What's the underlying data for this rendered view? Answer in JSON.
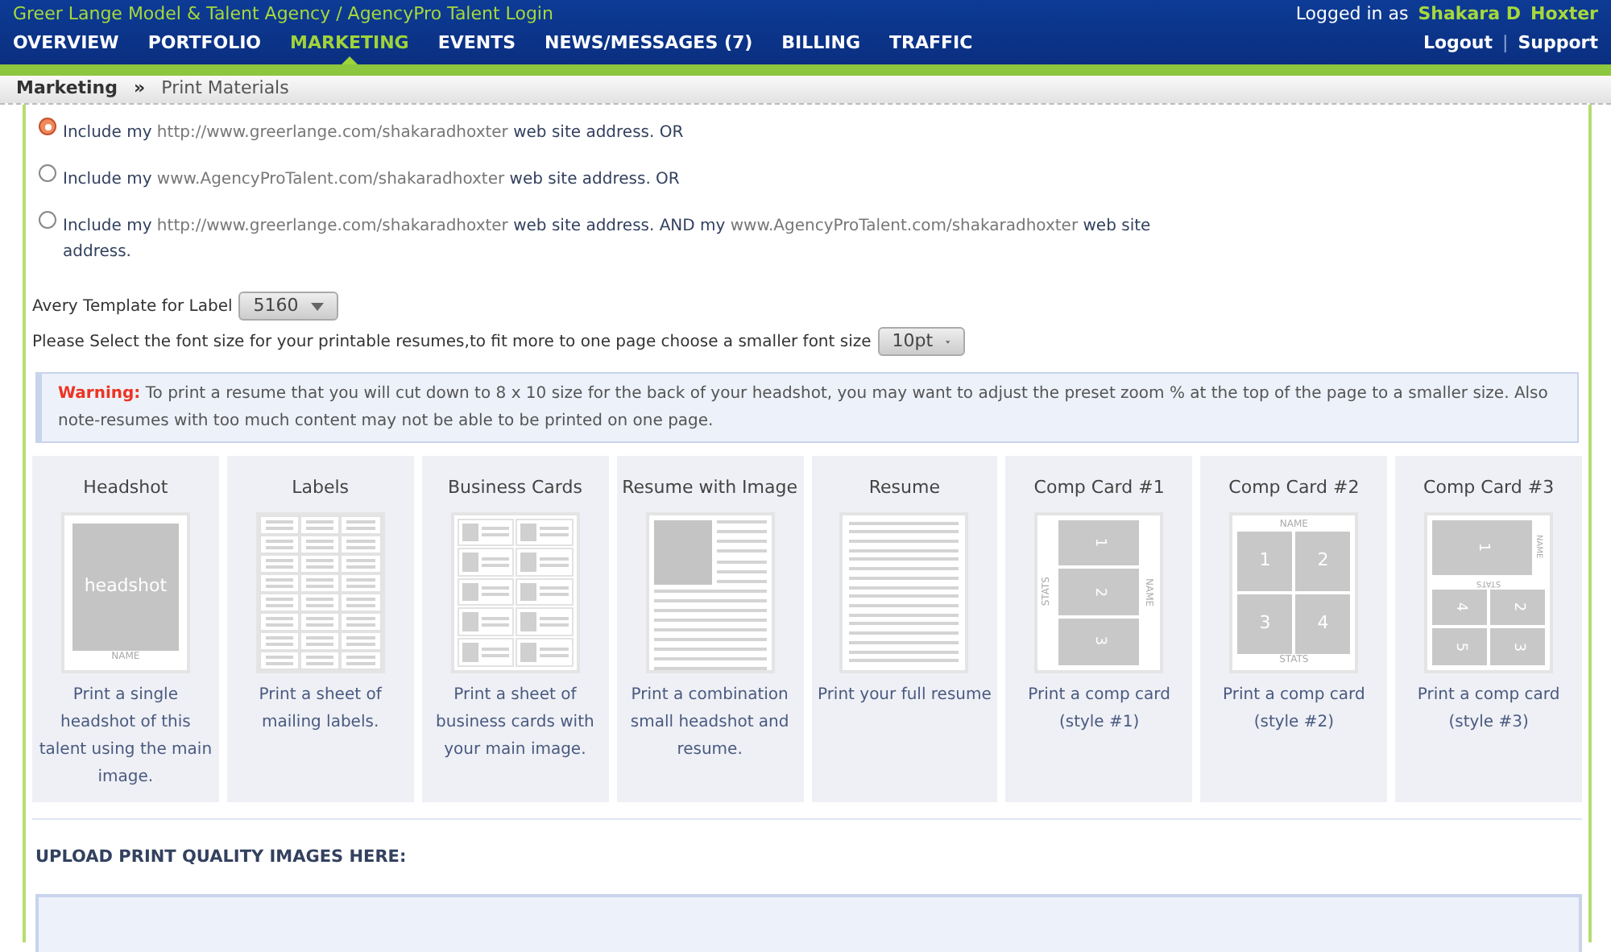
{
  "header": {
    "title": "Greer Lange Model & Talent Agency / AgencyPro Talent Login",
    "logged_in_label": "Logged in as",
    "user_first": "Shakara D",
    "user_last": "Hoxter",
    "nav": [
      {
        "label": "OVERVIEW",
        "selected": false
      },
      {
        "label": "PORTFOLIO",
        "selected": false
      },
      {
        "label": "MARKETING",
        "selected": true
      },
      {
        "label": "EVENTS",
        "selected": false
      },
      {
        "label": "NEWS/MESSAGES (7)",
        "selected": false
      },
      {
        "label": "BILLING",
        "selected": false
      },
      {
        "label": "TRAFFIC",
        "selected": false
      }
    ],
    "links": [
      "Logout",
      "Support"
    ],
    "link_separator": "|"
  },
  "breadcrumb": {
    "items": [
      "Marketing",
      "Print Materials"
    ],
    "separator": "»"
  },
  "address_options": [
    {
      "selected": true,
      "parts": [
        {
          "kind": "plain",
          "text": "Include my"
        },
        {
          "kind": "url",
          "text": "http://www.greerlange.com/shakaradhoxter"
        },
        {
          "kind": "plain",
          "text": "web site address. OR"
        }
      ]
    },
    {
      "selected": false,
      "parts": [
        {
          "kind": "plain",
          "text": "Include my"
        },
        {
          "kind": "url",
          "text": "www.AgencyProTalent.com/shakaradhoxter"
        },
        {
          "kind": "plain",
          "text": "web site address. OR"
        }
      ]
    },
    {
      "selected": false,
      "parts": [
        {
          "kind": "plain",
          "text": "Include my"
        },
        {
          "kind": "url",
          "text": "http://www.greerlange.com/shakaradhoxter"
        },
        {
          "kind": "plain",
          "text": "web site address. AND my"
        },
        {
          "kind": "url",
          "text": "www.AgencyProTalent.com/shakaradhoxter"
        },
        {
          "kind": "plain",
          "text": "web site address."
        }
      ]
    }
  ],
  "avery": {
    "label": "Avery Template for Label",
    "value": "5160"
  },
  "font_size": {
    "label": "Please Select the font size for your printable resumes,to fit more to one page choose a smaller font size",
    "value": "10pt"
  },
  "warning": {
    "label": "Warning:",
    "text": "To print a resume that you will cut down to 8 x 10 size for the back of your headshot, you may want to adjust the preset zoom % at the top of the page to a smaller size. Also note-resumes with too much content may not be able to be printed on one page."
  },
  "print_options": [
    {
      "kind": "headshot",
      "title": "Headshot",
      "thumb_labels": [
        "headshot",
        "NAME"
      ],
      "description": "Print a single headshot of this talent using the main image."
    },
    {
      "kind": "labels",
      "title": "Labels",
      "description": "Print a sheet of mailing labels."
    },
    {
      "kind": "business_cards",
      "title": "Business Cards",
      "description": "Print a sheet of business cards with your main image."
    },
    {
      "kind": "resume_image",
      "title": "Resume with Image",
      "description": "Print a combination small headshot and resume."
    },
    {
      "kind": "resume",
      "title": "Resume",
      "description": "Print your full resume"
    },
    {
      "kind": "comp1",
      "title": "Comp Card #1",
      "thumb_labels": [
        "1",
        "2",
        "3",
        "STATS",
        "NAME"
      ],
      "description": "Print a comp card (style #1)"
    },
    {
      "kind": "comp2",
      "title": "Comp Card #2",
      "thumb_labels": [
        "NAME",
        "1",
        "2",
        "3",
        "4",
        "STATS"
      ],
      "description": "Print a comp card (style #2)"
    },
    {
      "kind": "comp3",
      "title": "Comp Card #3",
      "thumb_labels": [
        "1",
        "NAME",
        "STATS",
        "4",
        "2",
        "5",
        "3"
      ],
      "description": "Print a comp card (style #3)"
    }
  ],
  "upload": {
    "heading": "UPLOAD PRINT QUALITY IMAGES HERE:"
  }
}
